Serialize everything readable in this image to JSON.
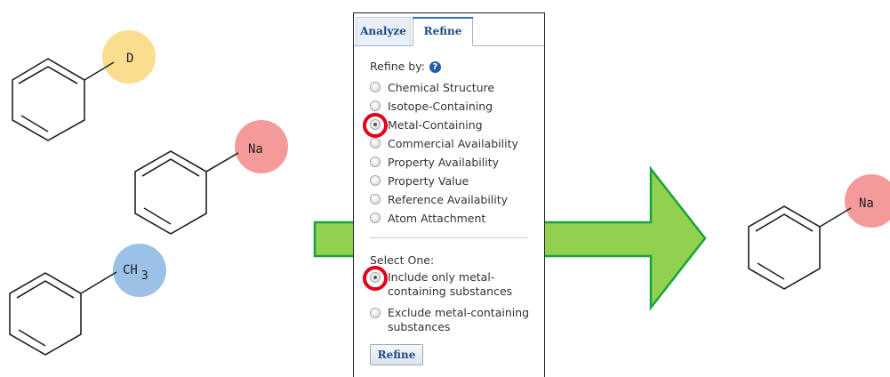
{
  "molecules": {
    "deuterio_label": "D",
    "sodio_label": "Na",
    "methyl_label": "CH",
    "methyl_subscript": "3",
    "result_label": "Na"
  },
  "colors": {
    "deuterium_circle": "#fbdd90",
    "sodium_circle": "#f59a9a",
    "methyl_circle": "#9bc1e6",
    "arrow_fill": "#92d050",
    "arrow_stroke": "#16a33a",
    "highlight_ring": "#e3001b",
    "tab_text": "#1f4b86"
  },
  "panel": {
    "tabs": {
      "analyze": "Analyze",
      "refine": "Refine"
    },
    "refine_by_label": "Refine by:",
    "options": [
      {
        "label": "Chemical Structure",
        "selected": false
      },
      {
        "label": "Isotope-Containing",
        "selected": false
      },
      {
        "label": "Metal-Containing",
        "selected": true
      },
      {
        "label": "Commercial Availability",
        "selected": false
      },
      {
        "label": "Property Availability",
        "selected": false
      },
      {
        "label": "Property Value",
        "selected": false
      },
      {
        "label": "Reference Availability",
        "selected": false
      },
      {
        "label": "Atom Attachment",
        "selected": false
      }
    ],
    "select_one_label": "Select One:",
    "choices": [
      {
        "label": "Include only metal-containing substances",
        "selected": true
      },
      {
        "label": "Exclude metal-containing substances",
        "selected": false
      }
    ],
    "refine_button": "Refine"
  }
}
